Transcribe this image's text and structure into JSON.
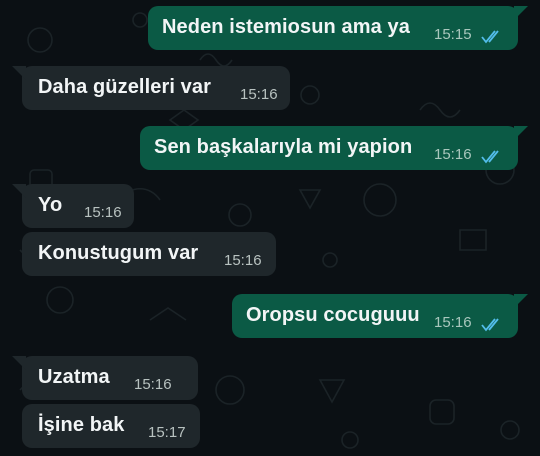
{
  "colors": {
    "background": "#0b1014",
    "outgoing_bubble": "#0b5a45",
    "incoming_bubble": "#1f272b",
    "read_ticks": "#53bdeb"
  },
  "messages": [
    {
      "direction": "outgoing",
      "text": "Neden istemiosun ama ya",
      "time": "15:15",
      "status_icon": "double-check-read-icon"
    },
    {
      "direction": "incoming",
      "text": "Daha güzelleri var",
      "time": "15:16"
    },
    {
      "direction": "outgoing",
      "text": "Sen başkalarıyla mi yapion",
      "time": "15:16",
      "status_icon": "double-check-read-icon"
    },
    {
      "direction": "incoming",
      "text": "Yo",
      "time": "15:16"
    },
    {
      "direction": "incoming",
      "text": "Konustugum var",
      "time": "15:16"
    },
    {
      "direction": "outgoing",
      "text": "Oropsu cocuguuu",
      "time": "15:16",
      "status_icon": "double-check-read-icon"
    },
    {
      "direction": "incoming",
      "text": "Uzatma",
      "time": "15:16"
    },
    {
      "direction": "incoming",
      "text": "İşine bak",
      "time": "15:17"
    }
  ]
}
